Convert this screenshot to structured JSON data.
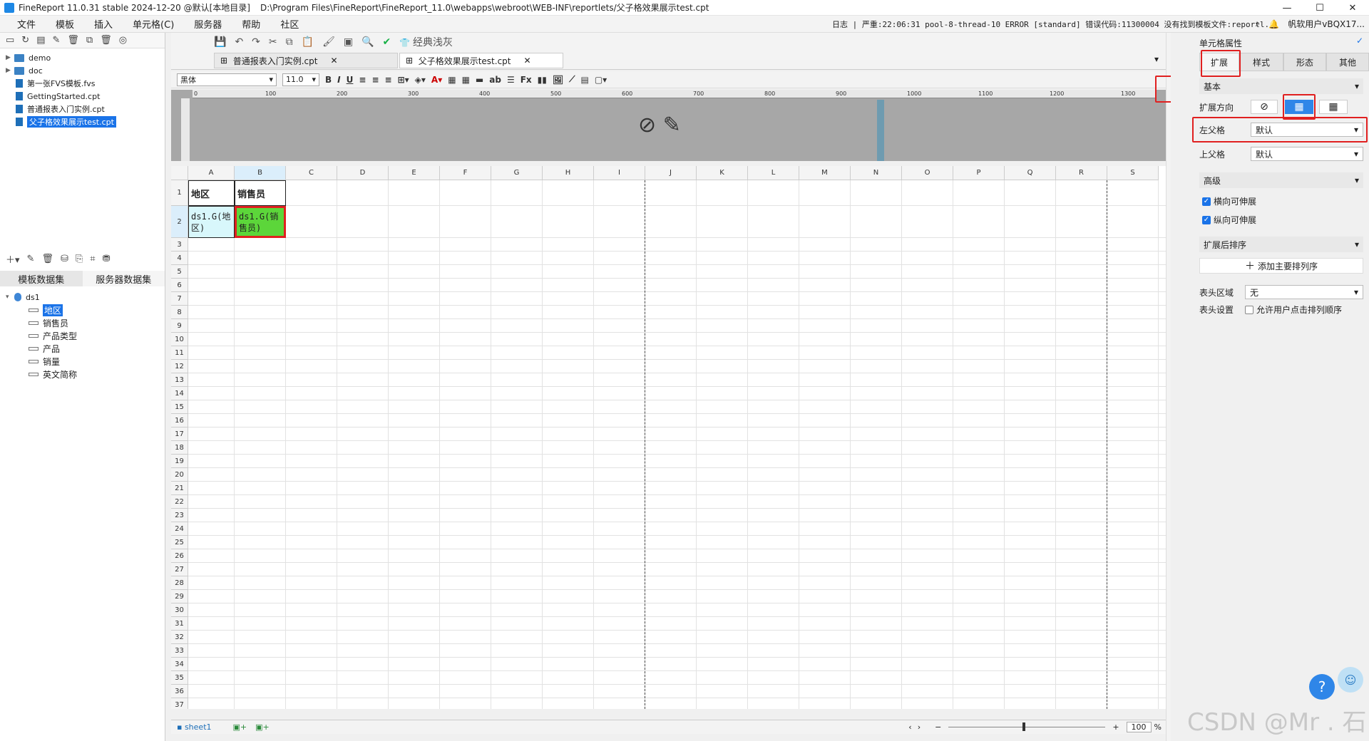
{
  "titlebar": {
    "app": "FineReport 11.0.31 stable 2024-12-20 @默认[本地目录]",
    "path": "D:\\Program Files\\FineReport\\FineReport_11.0\\webapps\\webroot\\WEB-INF\\reportlets/父子格效果展示test.cpt"
  },
  "menu": [
    "文件",
    "模板",
    "插入",
    "单元格(C)",
    "服务器",
    "帮助",
    "社区"
  ],
  "status": {
    "log": "日志",
    "text": "严重:22:06:31 pool-8-thread-10 ERROR [standard] 错误代码:11300004 没有找到模板文件:reportl...",
    "user": "帆软用户vBQX17..."
  },
  "tree": [
    {
      "label": "demo",
      "type": "folder"
    },
    {
      "label": "doc",
      "type": "folder"
    },
    {
      "label": "第一张FVS模板.fvs",
      "type": "file"
    },
    {
      "label": "GettingStarted.cpt",
      "type": "file"
    },
    {
      "label": "普通报表入门实例.cpt",
      "type": "file"
    },
    {
      "label": "父子格效果展示test.cpt",
      "type": "file",
      "selected": true
    }
  ],
  "dataset_tabs": [
    "模板数据集",
    "服务器数据集"
  ],
  "dataset": {
    "name": "ds1",
    "fields": [
      "地区",
      "销售员",
      "产品类型",
      "产品",
      "销量",
      "英文简称"
    ],
    "selected_field": "地区"
  },
  "toolbar": {
    "theme_label": "经典浅灰"
  },
  "file_tabs": [
    "普通报表入门实例.cpt",
    "父子格效果展示test.cpt"
  ],
  "format": {
    "font": "黑体",
    "size": "11.0"
  },
  "ruler_ticks": [
    "0",
    "100",
    "200",
    "300",
    "400",
    "500",
    "600",
    "700",
    "800",
    "900",
    "1000",
    "1100",
    "1200",
    "1300"
  ],
  "columns": [
    "A",
    "B",
    "C",
    "D",
    "E",
    "F",
    "G",
    "H",
    "I",
    "J",
    "K",
    "L",
    "M",
    "N",
    "O",
    "P",
    "Q",
    "R",
    "S"
  ],
  "rows": 37,
  "cells": {
    "A1": "地区",
    "B1": "销售员",
    "A2": "ds1.G(地区)",
    "B2": "ds1.G(销售员)"
  },
  "sheet": {
    "name": "sheet1",
    "zoom": "100",
    "zoom_unit": "%"
  },
  "panel": {
    "title": "单元格属性",
    "tabs": [
      "扩展",
      "样式",
      "形态",
      "其他"
    ],
    "basic": "基本",
    "expand_direction_label": "扩展方向",
    "left_parent_label": "左父格",
    "left_parent_value": "默认",
    "top_parent_label": "上父格",
    "top_parent_value": "默认",
    "advanced": "高级",
    "horizontal_stretch": "横向可伸展",
    "vertical_stretch": "纵向可伸展",
    "sort_section": "扩展后排序",
    "add_sort": "添加主要排列序",
    "header_area_label": "表头区域",
    "header_area_value": "无",
    "header_setting_label": "表头设置",
    "allow_user_sort": "允许用户点击排列顺序"
  },
  "watermark": "CSDN @Mr . 石",
  "colors": {
    "accent": "#1a73e8",
    "highlight": "#e02020",
    "cell_green": "#5cd63a",
    "cell_cyan": "#d8f7fb"
  }
}
